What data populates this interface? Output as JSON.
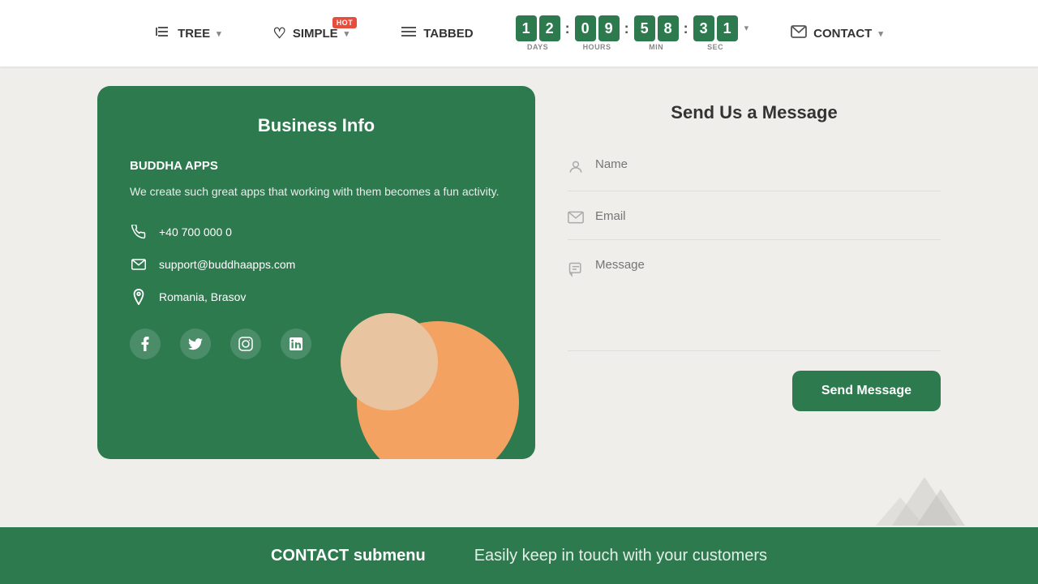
{
  "navbar": {
    "items": [
      {
        "id": "tree",
        "label": "TREE",
        "icon": "⊣",
        "hasDropdown": true,
        "hot": false
      },
      {
        "id": "simple",
        "label": "SIMPLE",
        "icon": "♡",
        "hasDropdown": true,
        "hot": true
      },
      {
        "id": "tabbed",
        "label": "TABBED",
        "icon": "≡",
        "hasDropdown": false,
        "hot": false
      },
      {
        "id": "contact",
        "label": "CONTACT",
        "icon": "✉",
        "hasDropdown": true,
        "hot": false
      }
    ],
    "hot_label": "HOT",
    "countdown": {
      "days": [
        "1",
        "2"
      ],
      "hours": [
        "0",
        "9"
      ],
      "minutes": [
        "5",
        "8"
      ],
      "seconds": [
        "3",
        "1"
      ],
      "labels": [
        "DAYS",
        "HOURS",
        "MIN",
        "SEC"
      ]
    }
  },
  "business_card": {
    "title": "Business Info",
    "company": "BUDDHA APPS",
    "description": "We create such great apps that working with them becomes a fun activity.",
    "phone": "+40 700 000 0",
    "email": "support@buddhaapps.com",
    "address": "Romania, Brasov",
    "social": [
      "f",
      "t",
      "in",
      "li"
    ]
  },
  "contact_form": {
    "title": "Send Us a Message",
    "name_placeholder": "Name",
    "email_placeholder": "Email",
    "message_placeholder": "Message",
    "send_label": "Send Message"
  },
  "bottom_banner": {
    "title": "CONTACT submenu",
    "subtitle": "Easily keep in touch with your customers"
  }
}
